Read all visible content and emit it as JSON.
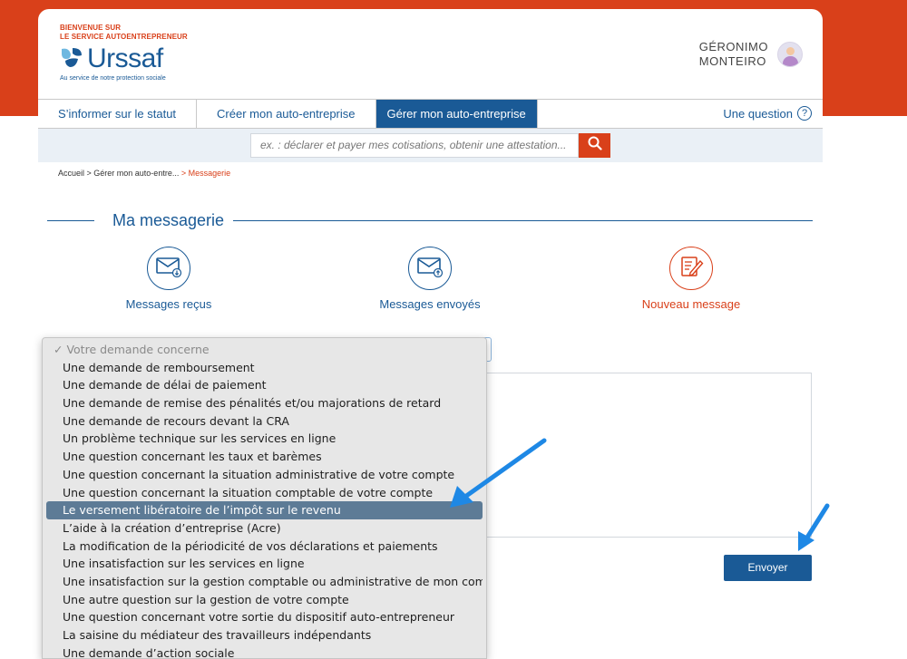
{
  "header": {
    "welcome_line1": "BIENVENUE SUR",
    "welcome_line2": "LE SERVICE AUTOENTREPRENEUR",
    "brand": "Urssaf",
    "tagline": "Au service de notre protection sociale",
    "user_first": "GÉRONIMO",
    "user_last": "MONTEIRO"
  },
  "nav": {
    "tabs": [
      {
        "label": "S’informer sur le statut"
      },
      {
        "label": "Créer mon auto-entreprise"
      },
      {
        "label": "Gérer mon auto-entreprise"
      }
    ],
    "question": "Une question",
    "question_mark": "?"
  },
  "search": {
    "placeholder": "ex. : déclarer et payer mes cotisations, obtenir une attestation..."
  },
  "breadcrumb": {
    "home": "Accueil",
    "sep1": " > ",
    "parent": "Gérer mon auto-entre...",
    "sep2": " > ",
    "current": "Messagerie"
  },
  "main": {
    "title": "Ma messagerie",
    "actions": [
      {
        "label": "Messages reçus"
      },
      {
        "label": "Messages envoyés"
      },
      {
        "label": "Nouveau message"
      }
    ],
    "send_label": "Envoyer"
  },
  "dropdown": {
    "header": "✓ Votre demande concerne",
    "selected_index": 8,
    "options": [
      "Une demande de remboursement",
      "Une demande de délai de paiement",
      "Une demande de remise des pénalités et/ou majorations de retard",
      "Une demande de recours devant la CRA",
      "Un problème technique sur les services en ligne",
      "Une question concernant les taux et barèmes",
      "Une question concernant la situation administrative de votre compte",
      "Une question concernant la situation comptable de votre compte",
      "Le versement libératoire de l’impôt sur le revenu",
      "L’aide à la création d’entreprise (Acre)",
      "La modification de la périodicité de vos déclarations et paiements",
      "Une insatisfaction sur les services en ligne",
      "Une insatisfaction sur la gestion comptable ou administrative de mon compte",
      "Une autre question sur la gestion de votre compte",
      "Une question concernant votre sortie du dispositif auto-entrepreneur",
      "La saisine du médiateur des travailleurs indépendants",
      "Une demande d’action sociale"
    ]
  },
  "colors": {
    "brand_blue": "#1a5a96",
    "accent_red": "#d9401a",
    "annotation_arrow": "#1e88e5",
    "selected_option": "#5d7b96"
  }
}
